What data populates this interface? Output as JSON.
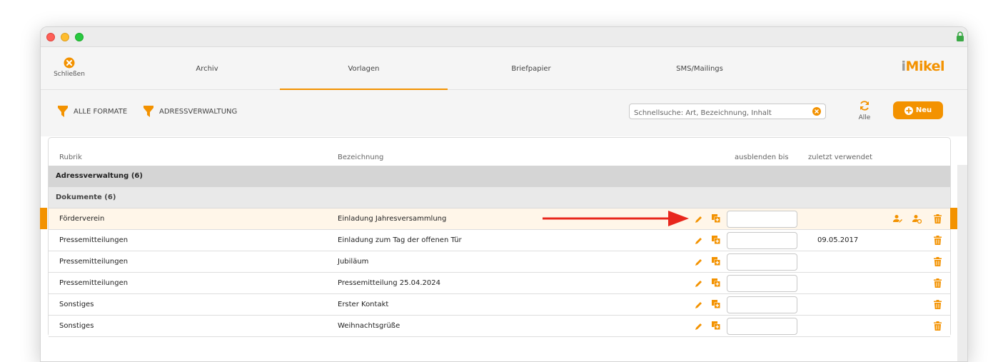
{
  "nav": {
    "close_label": "Schließen",
    "tabs": [
      "Archiv",
      "Vorlagen",
      "Briefpapier",
      "SMS/Mailings"
    ],
    "active_tab": "Vorlagen",
    "logo_prefix": "i",
    "logo_rest": "Mikel"
  },
  "toolbar": {
    "filter1": "ALLE FORMATE",
    "filter2": "ADRESSVERWALTUNG",
    "search_placeholder": "Schnellsuche: Art, Bezeichnung, Inhalt",
    "alle_label": "Alle",
    "new_label": "Neu"
  },
  "table": {
    "headers": {
      "rubrik": "Rubrik",
      "bezeichnung": "Bezeichnung",
      "ausblenden": "ausblenden bis",
      "zuletzt": "zuletzt verwendet"
    },
    "group1": "Adressverwaltung (6)",
    "group2": "Dokumente (6)",
    "rows": [
      {
        "rubrik": "Förderverein",
        "bezeichnung": "Einladung Jahresversammlung",
        "ausblenden": "",
        "zuletzt": "",
        "selected": true
      },
      {
        "rubrik": "Pressemitteilungen",
        "bezeichnung": "Einladung zum Tag der offenen Tür",
        "ausblenden": "",
        "zuletzt": "09.05.2017",
        "selected": false
      },
      {
        "rubrik": "Pressemitteilungen",
        "bezeichnung": "Jubiläum",
        "ausblenden": "",
        "zuletzt": "",
        "selected": false
      },
      {
        "rubrik": "Pressemitteilungen",
        "bezeichnung": "Pressemitteilung 25.04.2024",
        "ausblenden": "",
        "zuletzt": "",
        "selected": false
      },
      {
        "rubrik": "Sonstiges",
        "bezeichnung": "Erster Kontakt",
        "ausblenden": "",
        "zuletzt": "",
        "selected": false
      },
      {
        "rubrik": "Sonstiges",
        "bezeichnung": "Weihnachtsgrüße",
        "ausblenden": "",
        "zuletzt": "",
        "selected": false
      }
    ]
  },
  "colors": {
    "accent": "#f39200",
    "arrow": "#e8271d",
    "selected_row": "#fff6e9"
  }
}
